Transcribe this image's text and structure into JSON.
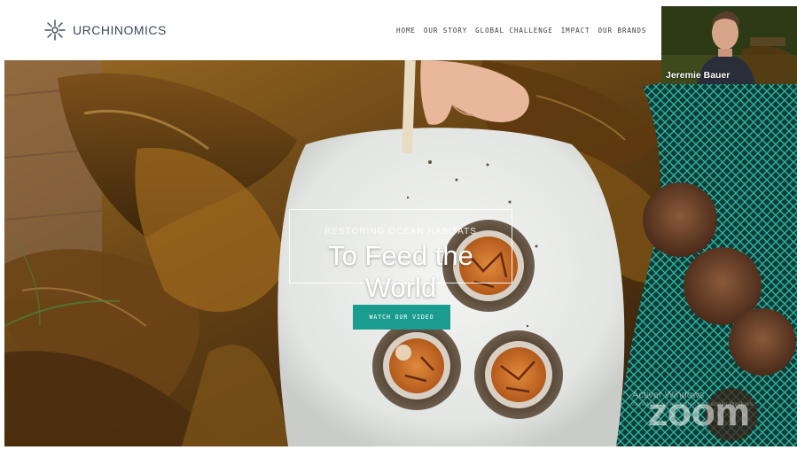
{
  "site": {
    "brand": "URCHINOMICS",
    "nav": [
      "HOME",
      "OUR STORY",
      "GLOBAL CHALLENGE",
      "IMPACT",
      "OUR BRANDS"
    ]
  },
  "hero": {
    "subtitle": "RESTORING OCEAN HABITATS",
    "title": "To Feed the World",
    "cta_label": "WATCH OUR VIDEO"
  },
  "meeting": {
    "participant_name": "Jeremie Bauer",
    "watermark": "zoom"
  },
  "os_watermark": {
    "title": "Activer Windows",
    "subtitle": "Accédez aux paramètres pour activer Windows."
  },
  "colors": {
    "accent": "#1a9d8f",
    "logo_text": "#3a4a5a",
    "nav_text": "#3c3c3c",
    "kelp_dark": "#3b2a12",
    "kelp_light": "#8a5a1a",
    "plate": "#e9ebe8",
    "net": "#2aa89a"
  },
  "icons": {
    "logo": "urchin-icon"
  }
}
